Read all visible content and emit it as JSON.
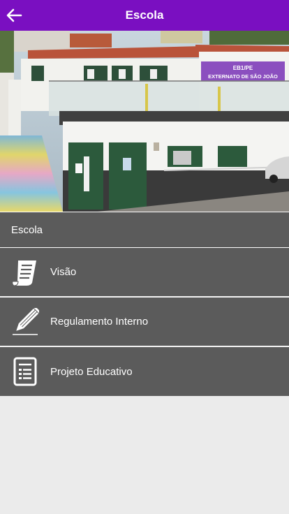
{
  "appbar": {
    "title": "Escola",
    "accent": "#7a0fc1"
  },
  "hero": {
    "sign_line1": "EB1/PE",
    "sign_line2": "EXTERNATO DE SÃO JOÃO"
  },
  "section": {
    "title": "Escola"
  },
  "menu": {
    "items": [
      {
        "label": "Visão",
        "icon": "document-scroll-icon"
      },
      {
        "label": "Regulamento Interno",
        "icon": "pencil-icon"
      },
      {
        "label": "Projeto Educativo",
        "icon": "document-list-icon"
      }
    ]
  },
  "colors": {
    "list_background": "#5b5b5b",
    "page_background": "#ebebeb"
  }
}
